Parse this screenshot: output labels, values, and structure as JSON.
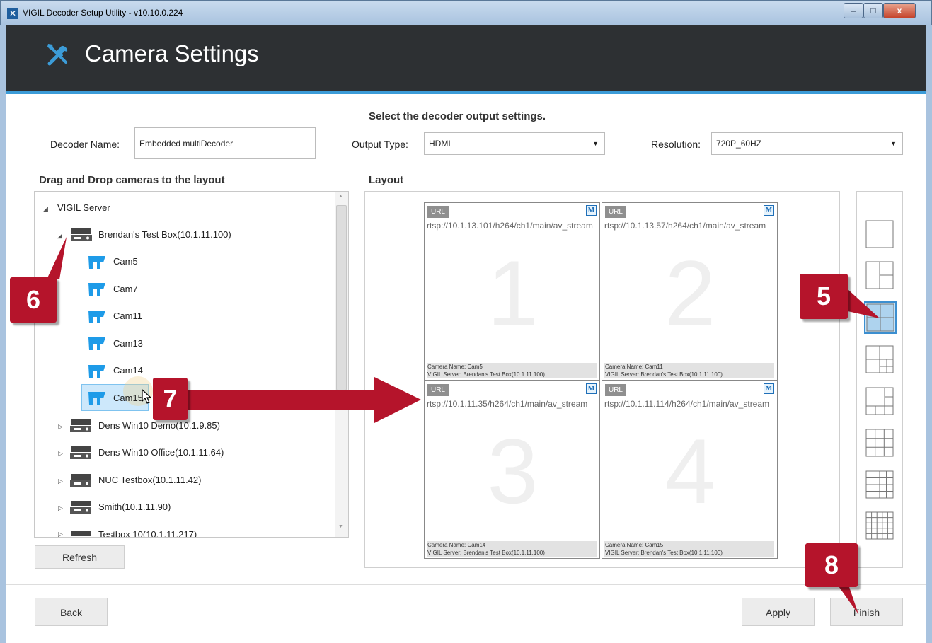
{
  "window": {
    "title": "VIGIL Decoder Setup Utility - v10.10.0.224",
    "minimize": "–",
    "maximize": "□",
    "close": "x"
  },
  "header": {
    "title": "Camera Settings",
    "icon": "tools-icon"
  },
  "decoder": {
    "instruction": "Select the decoder output settings.",
    "name_label": "Decoder Name:",
    "name_value": "Embedded multiDecoder",
    "output_label": "Output Type:",
    "output_value": "HDMI",
    "resolution_label": "Resolution:",
    "resolution_value": "720P_60HZ"
  },
  "tree": {
    "heading": "Drag and Drop cameras to the layout",
    "root": "VIGIL Server",
    "servers": [
      {
        "label": "Brendan's Test Box(10.1.11.100)",
        "expanded": true,
        "cameras": [
          "Cam5",
          "Cam7",
          "Cam11",
          "Cam13",
          "Cam14",
          "Cam15"
        ]
      },
      {
        "label": "Dens Win10 Demo(10.1.9.85)"
      },
      {
        "label": "Dens Win10 Office(10.1.11.64)"
      },
      {
        "label": "NUC Testbox(10.1.11.42)"
      },
      {
        "label": "Smith(10.1.11.90)"
      },
      {
        "label": "Testbox 10(10.1.11.217)"
      }
    ],
    "selected_camera": "Cam15",
    "refresh_label": "Refresh"
  },
  "layout": {
    "heading": "Layout",
    "cells": [
      {
        "num": "1",
        "url_badge": "URL",
        "m_badge": "M",
        "url": "rtsp://10.1.13.101/h264/ch1/main/av_stream",
        "camera": "Camera Name: Cam5",
        "server": "VIGIL Server: Brendan's Test Box(10.1.11.100)"
      },
      {
        "num": "2",
        "url_badge": "URL",
        "m_badge": "M",
        "url": "rtsp://10.1.13.57/h264/ch1/main/av_stream",
        "camera": "Camera Name: Cam11",
        "server": "VIGIL Server: Brendan's Test Box(10.1.11.100)"
      },
      {
        "num": "3",
        "url_badge": "URL",
        "m_badge": "M",
        "url": "rtsp://10.1.11.35/h264/ch1/main/av_stream",
        "camera": "Camera Name: Cam14",
        "server": "VIGIL Server: Brendan's Test Box(10.1.11.100)"
      },
      {
        "num": "4",
        "url_badge": "URL",
        "m_badge": "M",
        "url": "rtsp://10.1.11.114/h264/ch1/main/av_stream",
        "camera": "Camera Name: Cam15",
        "server": "VIGIL Server: Brendan's Test Box(10.1.11.100)"
      }
    ],
    "options": [
      "1x1",
      "1+1",
      "2x2",
      "1+3",
      "1+5",
      "3x3",
      "4x4",
      "5x5"
    ],
    "selected_option": "2x2"
  },
  "footer": {
    "back_label": "Back",
    "apply_label": "Apply",
    "finish_label": "Finish"
  },
  "callouts": [
    "6",
    "7",
    "5",
    "8"
  ],
  "colors": {
    "header_bg": "#2d3033",
    "accent": "#3c9cd8",
    "callout": "#b5142b",
    "camera_icon": "#1e9be8",
    "selection": "#cde8fb"
  }
}
